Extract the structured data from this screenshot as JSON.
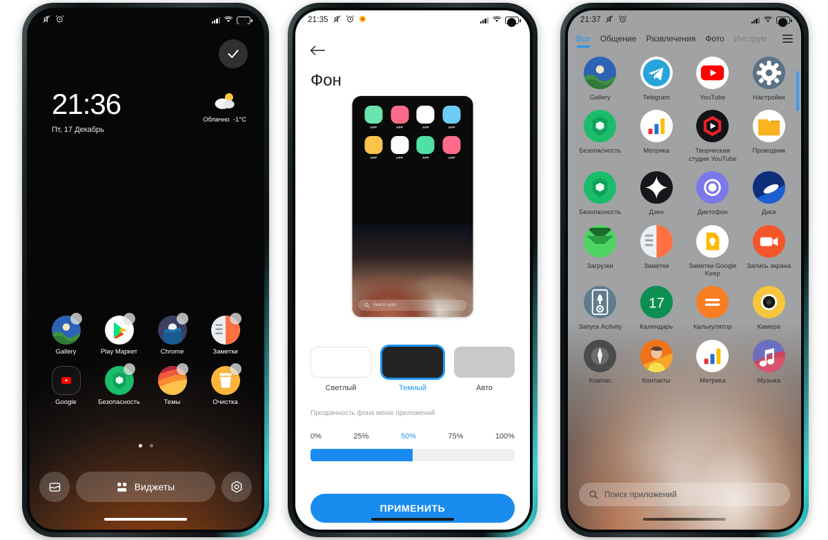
{
  "phone1": {
    "status": {
      "time": "",
      "icons": [
        "mute-icon",
        "alarm-icon"
      ],
      "signal": "signal-icon",
      "wifi": "wifi-icon",
      "battery": "62"
    },
    "confirm_button": "check-icon",
    "clock": {
      "time": "21:36",
      "date": "Пт, 17 Декабрь"
    },
    "weather": {
      "icon": "partly-cloudy-icon",
      "condition": "Облачно",
      "temp": "-1°C"
    },
    "apps": [
      {
        "label": "Gallery",
        "icon": "gallery-icon"
      },
      {
        "label": "Play Маркет",
        "icon": "play-store-icon"
      },
      {
        "label": "Chrome",
        "icon": "chrome-icon"
      },
      {
        "label": "Заметки",
        "icon": "notes-icon"
      },
      {
        "label": "Google",
        "icon": "google-folder-icon"
      },
      {
        "label": "Безопасность",
        "icon": "security-icon"
      },
      {
        "label": "Темы",
        "icon": "themes-icon"
      },
      {
        "label": "Очистка",
        "icon": "cleaner-icon"
      }
    ],
    "page_dots": 2,
    "dock": {
      "wallpaper_button": "wallpaper-icon",
      "widgets_label": "Виджеты",
      "widgets_icon": "widgets-icon",
      "settings_button": "settings-icon"
    }
  },
  "phone2": {
    "status": {
      "time": "21:35",
      "icons": [
        "mute-icon",
        "alarm-icon",
        "record-icon"
      ],
      "battery": "62"
    },
    "back": "back-arrow-icon",
    "title": "Фон",
    "preview": {
      "apps": [
        {
          "label": "APP",
          "color": "#6ae5ae"
        },
        {
          "label": "APP",
          "color": "#ff6b8a"
        },
        {
          "label": "APP",
          "color": "#ffffff"
        },
        {
          "label": "APP",
          "color": "#6dcbf8"
        },
        {
          "label": "APP",
          "color": "#fcc44d"
        },
        {
          "label": "APP",
          "color": "#ffffff"
        },
        {
          "label": "APP",
          "color": "#4fe0a5"
        },
        {
          "label": "APP",
          "color": "#ff6b8a"
        }
      ],
      "search_placeholder": "Search apps"
    },
    "themes": [
      {
        "label": "Светлый",
        "selected": false
      },
      {
        "label": "Темный",
        "selected": true
      },
      {
        "label": "Авто",
        "selected": false
      }
    ],
    "slider": {
      "caption": "Прозрачность фона меню приложений",
      "ticks": [
        "0%",
        "25%",
        "50%",
        "75%",
        "100%"
      ],
      "active_tick": "50%",
      "value": 50
    },
    "apply_label": "ПРИМЕНИТЬ",
    "accent_color": "#1a8cf0"
  },
  "phone3": {
    "status": {
      "time": "21:37",
      "icons": [
        "mute-icon",
        "alarm-icon"
      ],
      "battery": "62"
    },
    "tabs": [
      {
        "label": "Все",
        "active": true
      },
      {
        "label": "Общение",
        "active": false
      },
      {
        "label": "Развлечения",
        "active": false
      },
      {
        "label": "Фото",
        "active": false
      },
      {
        "label": "Инструм",
        "active": false
      }
    ],
    "tab_menu_icon": "hamburger-icon",
    "apps": [
      {
        "label": "Gallery",
        "icon": "gallery-icon"
      },
      {
        "label": "Telegram",
        "icon": "telegram-icon"
      },
      {
        "label": "YouTube",
        "icon": "youtube-icon"
      },
      {
        "label": "Настройки",
        "icon": "settings-gear-icon"
      },
      {
        "label": "Безопасность",
        "icon": "security-icon"
      },
      {
        "label": "Метрика",
        "icon": "metrica-icon"
      },
      {
        "label": "Творческая студия YouTube",
        "icon": "youtube-studio-icon"
      },
      {
        "label": "Проводник",
        "icon": "file-explorer-icon"
      },
      {
        "label": "Безопасность",
        "icon": "security-icon"
      },
      {
        "label": "Дзен",
        "icon": "zen-icon"
      },
      {
        "label": "Диктофон",
        "icon": "recorder-icon"
      },
      {
        "label": "Диск",
        "icon": "yandex-disk-icon"
      },
      {
        "label": "Загрузки",
        "icon": "downloads-icon"
      },
      {
        "label": "Заметки",
        "icon": "notes-icon"
      },
      {
        "label": "Заметки Google Keep",
        "icon": "google-keep-icon"
      },
      {
        "label": "Запись экрана",
        "icon": "screen-record-icon"
      },
      {
        "label": "Запуск Activity",
        "icon": "activity-launcher-icon"
      },
      {
        "label": "Календарь",
        "icon": "calendar-icon",
        "badge": "17"
      },
      {
        "label": "Калькулятор",
        "icon": "calculator-icon"
      },
      {
        "label": "Камера",
        "icon": "camera-icon"
      },
      {
        "label": "Компас",
        "icon": "compass-icon"
      },
      {
        "label": "Контакты",
        "icon": "contacts-icon"
      },
      {
        "label": "Метрика",
        "icon": "metrica-icon"
      },
      {
        "label": "Музыка",
        "icon": "music-icon"
      }
    ],
    "search_placeholder": "Поиск приложений",
    "accent_color": "#2196f3"
  }
}
